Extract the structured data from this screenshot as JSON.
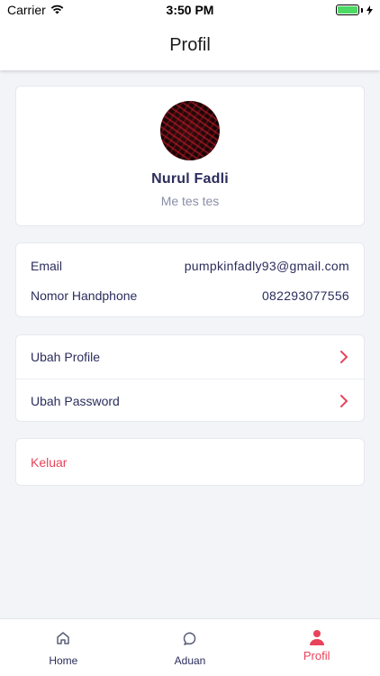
{
  "status_bar": {
    "carrier": "Carrier",
    "time": "3:50 PM",
    "battery_level": 1.0
  },
  "header": {
    "title": "Profil"
  },
  "profile": {
    "name": "Nurul Fadli",
    "bio": "Me tes tes"
  },
  "info": {
    "email_label": "Email",
    "email_value": "pumpkinfadly93@gmail.com",
    "phone_label": "Nomor Handphone",
    "phone_value": "082293077556"
  },
  "menu": {
    "items": [
      {
        "label": "Ubah Profile",
        "icon": "chevron-right-icon"
      },
      {
        "label": "Ubah Password",
        "icon": "chevron-right-icon"
      }
    ]
  },
  "logout": {
    "label": "Keluar"
  },
  "tab_bar": {
    "tabs": [
      {
        "label": "Home",
        "icon": "home-icon",
        "active": false
      },
      {
        "label": "Aduan",
        "icon": "chat-bubble-icon",
        "active": false
      },
      {
        "label": "Profil",
        "icon": "person-icon",
        "active": true
      }
    ]
  },
  "colors": {
    "accent": "#e8435a",
    "text_primary": "#2b2d5c",
    "text_muted": "#8a8ea8",
    "background": "#f3f4f8",
    "battery": "#4cd964"
  }
}
